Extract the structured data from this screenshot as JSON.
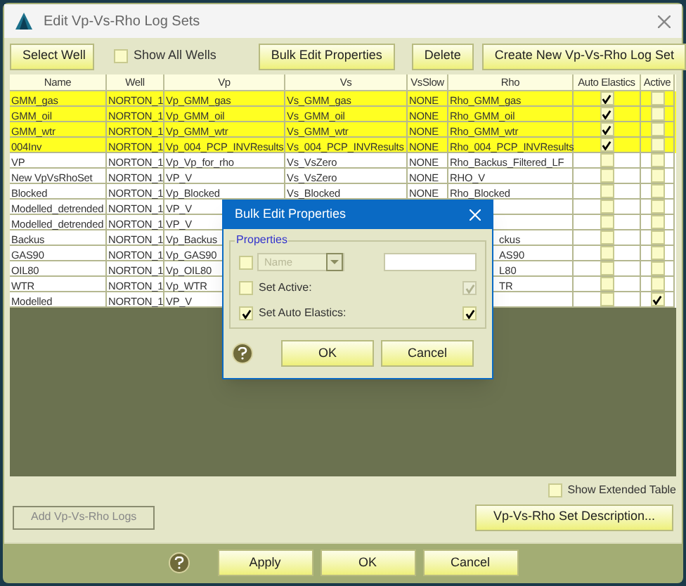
{
  "window": {
    "title": "Edit Vp-Vs-Rho Log Sets"
  },
  "toolbar": {
    "select_well": "Select Well",
    "show_all_wells": {
      "label": "Show All Wells",
      "checked": false
    },
    "bulk_edit": "Bulk Edit Properties",
    "delete": "Delete",
    "create": "Create New Vp-Vs-Rho Log Set"
  },
  "table": {
    "columns": [
      "Name",
      "Well",
      "Vp",
      "Vs",
      "VsSlow",
      "Rho",
      "Auto Elastics",
      "Active"
    ],
    "rows": [
      {
        "name": "GMM_gas",
        "well": "NORTON_1",
        "vp": "Vp_GMM_gas",
        "vs": "Vs_GMM_gas",
        "vs_slow": "NONE",
        "rho": "Rho_GMM_gas",
        "auto_elastics": true,
        "active": false,
        "selected": true
      },
      {
        "name": "GMM_oil",
        "well": "NORTON_1",
        "vp": "Vp_GMM_oil",
        "vs": "Vs_GMM_oil",
        "vs_slow": "NONE",
        "rho": "Rho_GMM_oil",
        "auto_elastics": true,
        "active": false,
        "selected": true
      },
      {
        "name": "GMM_wtr",
        "well": "NORTON_1",
        "vp": "Vp_GMM_wtr",
        "vs": "Vs_GMM_wtr",
        "vs_slow": "NONE",
        "rho": "Rho_GMM_wtr",
        "auto_elastics": true,
        "active": false,
        "selected": true
      },
      {
        "name": "004Inv",
        "well": "NORTON_1",
        "vp": "Vp_004_PCP_INVResults",
        "vs": "Vs_004_PCP_INVResults",
        "vs_slow": "NONE",
        "rho": "Rho_004_PCP_INVResults",
        "auto_elastics": true,
        "active": false,
        "selected": true
      },
      {
        "name": "VP",
        "well": "NORTON_1",
        "vp": "Vp_Vp_for_rho",
        "vs": "Vs_VsZero",
        "vs_slow": "NONE",
        "rho": "Rho_Backus_Filtered_LF",
        "auto_elastics": false,
        "active": false,
        "selected": false
      },
      {
        "name": "New VpVsRhoSet",
        "well": "NORTON_1",
        "vp": "VP_V",
        "vs": "Vs_VsZero",
        "vs_slow": "NONE",
        "rho": "RHO_V",
        "auto_elastics": false,
        "active": false,
        "selected": false
      },
      {
        "name": "Blocked",
        "well": "NORTON_1",
        "vp": "Vp_Blocked",
        "vs": "Vs_Blocked",
        "vs_slow": "NONE",
        "rho": "Rho_Blocked",
        "auto_elastics": false,
        "active": false,
        "selected": false
      },
      {
        "name": "Modelled_detrended",
        "well": "NORTON_1",
        "vp": "VP_V",
        "auto_elastics": false,
        "active": false,
        "selected": false
      },
      {
        "name": "Modelled_detrended",
        "well": "NORTON_1",
        "vp": "VP_V",
        "auto_elastics": false,
        "active": false,
        "selected": false
      },
      {
        "name": "Backus",
        "well": "NORTON_1",
        "vp": "Vp_Backus",
        "rho_tail": "ckus",
        "auto_elastics": false,
        "active": false,
        "selected": false
      },
      {
        "name": "GAS90",
        "well": "NORTON_1",
        "vp": "Vp_GAS90",
        "rho_tail": "AS90",
        "auto_elastics": false,
        "active": false,
        "selected": false
      },
      {
        "name": "OIL80",
        "well": "NORTON_1",
        "vp": "Vp_OIL80",
        "rho_tail": "L80",
        "auto_elastics": false,
        "active": false,
        "selected": false
      },
      {
        "name": "WTR",
        "well": "NORTON_1",
        "vp": "Vp_WTR",
        "rho_tail": "TR",
        "auto_elastics": false,
        "active": false,
        "selected": false
      },
      {
        "name": "Modelled",
        "well": "NORTON_1",
        "vp": "VP_V",
        "auto_elastics": false,
        "active": true,
        "selected": false
      }
    ]
  },
  "dialog": {
    "title": "Bulk Edit Properties",
    "group": "Properties",
    "property": {
      "checked": false,
      "value": "Name",
      "disabled": true
    },
    "set_active": {
      "label": "Set Active:",
      "checked": false,
      "value_checked": true,
      "value_disabled": true
    },
    "set_auto_elastics": {
      "label": "Set Auto Elastics:",
      "checked": true,
      "value_checked": true,
      "value_disabled": false
    },
    "ok": "OK",
    "cancel": "Cancel"
  },
  "show_extended_table": {
    "label": "Show Extended Table",
    "checked": false
  },
  "add_logs": {
    "label": "Add Vp-Vs-Rho Logs",
    "disabled": true
  },
  "set_description": "Vp-Vs-Rho Set Description...",
  "footer": {
    "apply": "Apply",
    "ok": "OK",
    "cancel": "Cancel"
  }
}
